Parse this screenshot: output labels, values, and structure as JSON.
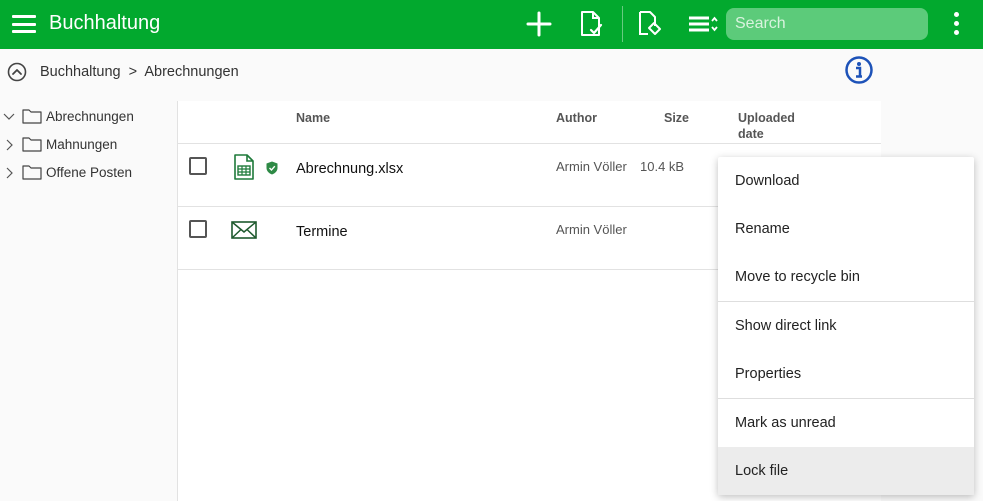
{
  "header": {
    "title": "Buchhaltung",
    "search_placeholder": "Search",
    "icons": [
      "menu-icon",
      "add-icon",
      "approve-document-icon",
      "tag-document-icon",
      "sort-list-icon",
      "more-vert-icon"
    ],
    "accent_color": "#02a92e"
  },
  "breadcrumb": {
    "root": "Buchhaltung",
    "separator": ">",
    "current": "Abrechnungen"
  },
  "tree": {
    "items": [
      {
        "label": "Abrechnungen",
        "expanded": true
      },
      {
        "label": "Mahnungen",
        "expanded": false
      },
      {
        "label": "Offene Posten",
        "expanded": false
      }
    ]
  },
  "table": {
    "columns": {
      "name": "Name",
      "author": "Author",
      "size": "Size",
      "uploaded_line1": "Uploaded",
      "uploaded_line2": "date"
    },
    "rows": [
      {
        "name": "Abrechnung.xlsx",
        "author": "Armin Völler",
        "size": "10.4 kB",
        "icon": "spreadsheet-icon",
        "status": "shield-check-icon"
      },
      {
        "name": "Termine",
        "author": "Armin Völler",
        "size": "",
        "icon": "mail-icon"
      }
    ]
  },
  "context_menu": {
    "items": [
      {
        "label": "Download"
      },
      {
        "label": "Rename"
      },
      {
        "label": "Move to recycle bin"
      },
      {
        "label": "Show direct link"
      },
      {
        "label": "Properties"
      },
      {
        "label": "Mark as unread"
      },
      {
        "label": "Lock file"
      }
    ]
  }
}
